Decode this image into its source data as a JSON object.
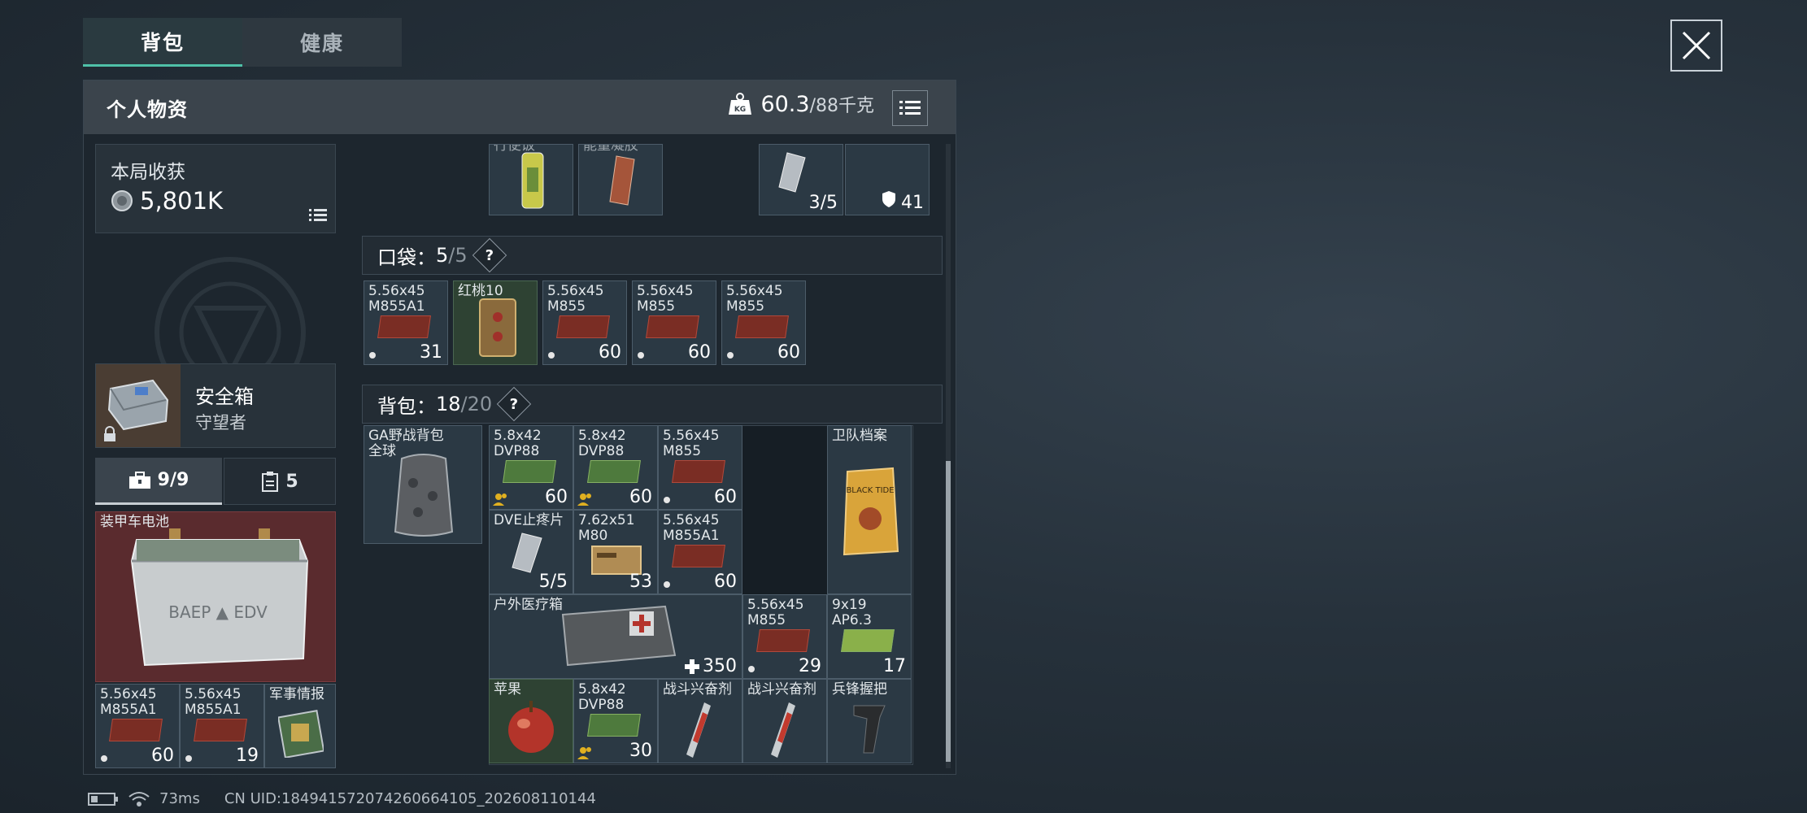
{
  "tabs": {
    "backpack": "背包",
    "health": "健康"
  },
  "panel": {
    "title": "个人物资",
    "weight_current": "60.3",
    "weight_max": "/88千克"
  },
  "harvest": {
    "label": "本局收获",
    "value": "5,801K"
  },
  "safebox": {
    "name": "安全箱",
    "sub": "守望者"
  },
  "left_tabs": {
    "case_count": "9/9",
    "other_count": "5"
  },
  "battery": {
    "name": "装甲车电池"
  },
  "left_bottom": [
    {
      "name": "5.56x45 M855A1",
      "count": "60"
    },
    {
      "name": "5.56x45 M855A1",
      "count": "19"
    },
    {
      "name": "军事情报",
      "count": ""
    }
  ],
  "top_partial": [
    {
      "name": "行便饭",
      "count": ""
    },
    {
      "name": "能量凝胶",
      "count": ""
    },
    {
      "name": "",
      "count": "3/5"
    },
    {
      "name": "",
      "count": "41"
    }
  ],
  "pocket": {
    "label": "口袋：",
    "cur": "5",
    "max": "/5",
    "help": "?"
  },
  "pocket_items": [
    {
      "name": "5.56x45 M855A1",
      "count": "31"
    },
    {
      "name": "红桃10",
      "count": ""
    },
    {
      "name": "5.56x45 M855",
      "count": "60"
    },
    {
      "name": "5.56x45 M855",
      "count": "60"
    },
    {
      "name": "5.56x45 M855",
      "count": "60"
    }
  ],
  "bag": {
    "label": "背包：",
    "cur": "18",
    "max": "/20",
    "help": "?"
  },
  "bag_item": {
    "name": "GA野战背包 全球",
    "items": [
      {
        "name": "5.8x42 DVP88",
        "count": "60"
      },
      {
        "name": "5.8x42 DVP88",
        "count": "60"
      },
      {
        "name": "5.56x45 M855",
        "count": "60"
      },
      {
        "name": "卫队档案",
        "count": ""
      },
      {
        "name": "DVE止疼片",
        "count": "5/5"
      },
      {
        "name": "7.62x51 M80",
        "count": "53"
      },
      {
        "name": "5.56x45 M855A1",
        "count": "60"
      },
      {
        "name": "户外医疗箱",
        "count": "350"
      },
      {
        "name": "5.56x45 M855",
        "count": "29"
      },
      {
        "name": "9x19 AP6.3",
        "count": "17"
      },
      {
        "name": "苹果",
        "count": ""
      },
      {
        "name": "5.8x42 DVP88",
        "count": "30"
      },
      {
        "name": "战斗兴奋剂",
        "count": ""
      },
      {
        "name": "战斗兴奋剂",
        "count": ""
      },
      {
        "name": "兵锋握把",
        "count": ""
      }
    ]
  },
  "status": {
    "ping": "73ms",
    "uid": "CN UID:1849415720742606641​05_202608110144"
  },
  "colors": {
    "accent": "#4fc1a8",
    "panel": "#1d262e",
    "cell": "#2b3944",
    "red_cell": "#5a2b2e"
  }
}
